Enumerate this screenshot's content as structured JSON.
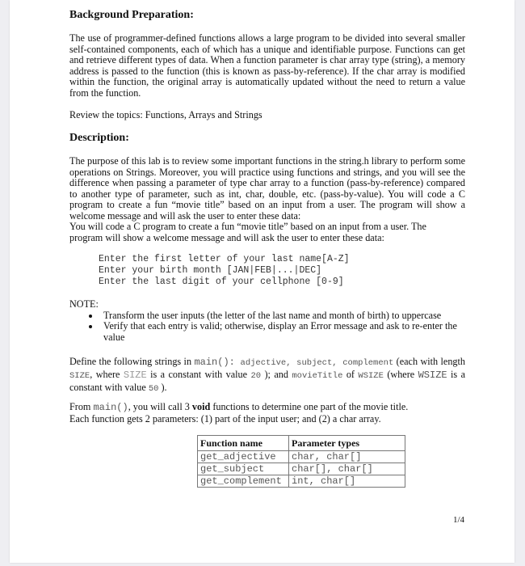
{
  "document": {
    "background_heading": "Background Preparation:",
    "background_paragraph": "The use of programmer-defined functions allows a large program to be divided into several smaller self-contained components, each of which has a unique and identifiable purpose. Functions can get and retrieve different types of data. When a function parameter is char array type (string), a memory address is passed to the function (this is known as pass-by-reference). If the char array is modified within the function, the original array is automatically updated without the need to return a value from the function.",
    "review_topics": "Review the topics: Functions, Arrays and Strings",
    "description_heading": "Description:",
    "description_paragraph_1": "The purpose of this lab is to review some important functions in the string.h library to perform some operations on Strings. Moreover, you will practice using functions and strings, and you will see the difference when passing a parameter of type char array to a function (pass-by-reference) compared to another type of parameter, such as int, char, double, etc. (pass-by-value). You will code a C program to create a fun “movie title” based on an input from a user. The program will show a welcome message and will ask the user to enter these data:",
    "description_paragraph_2a": "You will code a C program to create a fun “movie title” based on an input from a user. The",
    "description_paragraph_2b": "program will show a welcome message and will ask the user to enter these data:",
    "prompts": [
      "Enter the first letter of your last name[A-Z]",
      "Enter your birth month [JAN|FEB|...|DEC]",
      "Enter the last digit of your cellphone [0-9]"
    ],
    "note_label": "NOTE:",
    "notes": [
      "Transform the user inputs (the letter of the last name and month of birth) to uppercase",
      "Verify that each entry is valid; otherwise, display an Error message and ask to re-enter the value"
    ],
    "define": {
      "t1": "Define the following strings in ",
      "main": "main():",
      "vars": " adjective, subject, complement",
      "t2": " (each with length ",
      "size1": "SIZE",
      "t3": ", where ",
      "size2": "SIZE",
      "t4": " is a constant with value ",
      "val20": "20",
      "t5": " ); and ",
      "movie": "movieTitle",
      "t6": " of ",
      "wsize1": "WSIZE",
      "t7": "  (where ",
      "wsize2": "WSIZE",
      "t8": " is a constant with value ",
      "val50": "50",
      "t9": " )."
    },
    "from_main": {
      "t1": "From ",
      "main": "main()",
      "t2": ", you will call 3 ",
      "void": "void",
      "t3": " functions to determine one part of the movie title.",
      "line2": "Each function gets 2 parameters: (1) part of the input user; and (2) a char array."
    },
    "table": {
      "headers": [
        "Function name",
        "Parameter types"
      ],
      "rows": [
        [
          "get_adjective",
          "char, char[]"
        ],
        [
          "get_subject",
          "char[], char[]"
        ],
        [
          "get_complement",
          "int, char[]"
        ]
      ]
    },
    "page_number": "1/4"
  }
}
